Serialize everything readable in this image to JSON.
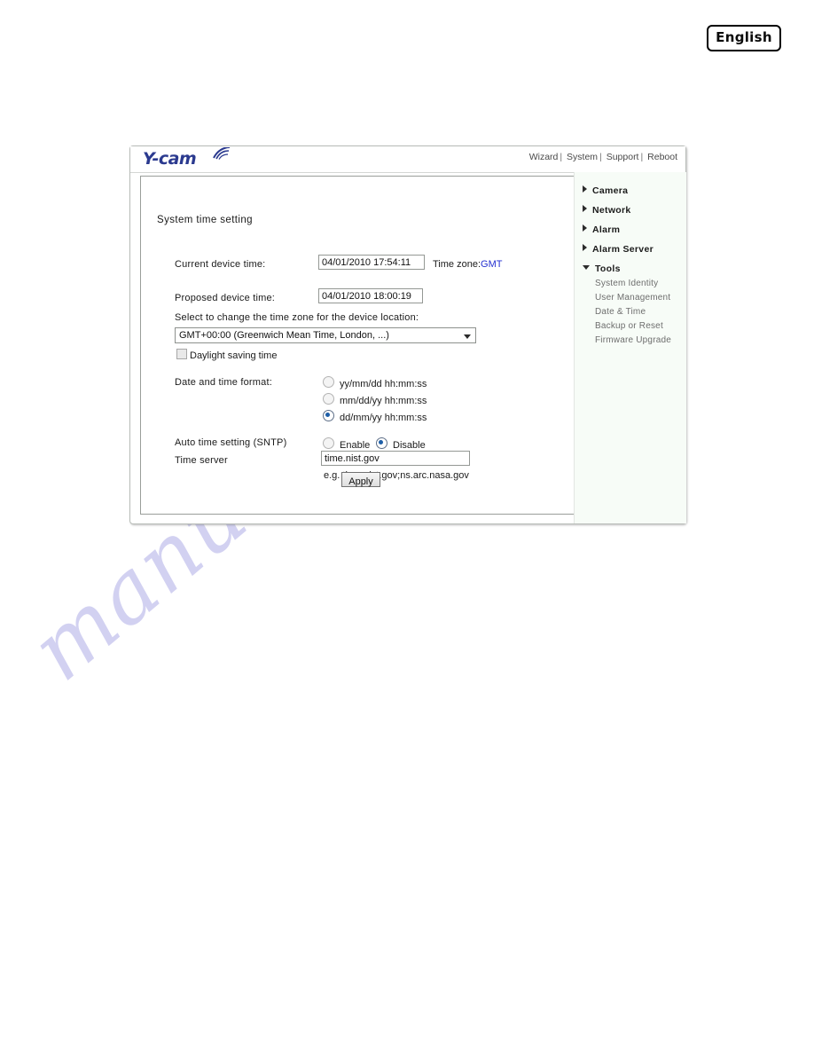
{
  "language_badge": {
    "label": "English"
  },
  "panel": {
    "logo_text": "Y-cam",
    "logo_icon": "wifi-arc-icon",
    "header_nav": [
      {
        "label": "Wizard"
      },
      {
        "label": "System"
      },
      {
        "label": "Support"
      },
      {
        "label": "Reboot"
      }
    ],
    "nav_separator": "|"
  },
  "content": {
    "section_title": "System time setting",
    "current_device_time": {
      "label": "Current device time:",
      "value": "04/01/2010 17:54:11"
    },
    "time_zone": {
      "label": "Time zone:",
      "value": "GMT"
    },
    "proposed_device_time": {
      "label": "Proposed device time:",
      "value": "04/01/2010 18:00:19"
    },
    "timezone_select": {
      "instruction": "Select to change the time zone for the device location:",
      "selected": "GMT+00:00 (Greenwich Mean Time, London, ...)",
      "arrow_icon": "chevron-down-icon"
    },
    "daylight_saving": {
      "label": "Daylight saving time",
      "checked": false
    },
    "date_time_format": {
      "label": "Date and time format:",
      "options": [
        {
          "label": "yy/mm/dd hh:mm:ss",
          "selected": false
        },
        {
          "label": "mm/dd/yy hh:mm:ss",
          "selected": false
        },
        {
          "label": "dd/mm/yy hh:mm:ss",
          "selected": true
        }
      ]
    },
    "sntp": {
      "label": "Auto time setting (SNTP)",
      "options": [
        {
          "label": "Enable",
          "selected": false
        },
        {
          "label": "Disable",
          "selected": true
        }
      ]
    },
    "time_server": {
      "label": "Time server",
      "value": "time.nist.gov",
      "hint": "e.g. time.nist.gov;ns.arc.nasa.gov"
    },
    "apply_button": {
      "label": "Apply"
    }
  },
  "sidebar": {
    "groups": [
      {
        "label": "Camera",
        "expanded": false,
        "icon": "triangle-right-icon"
      },
      {
        "label": "Network",
        "expanded": false,
        "icon": "triangle-right-icon"
      },
      {
        "label": "Alarm",
        "expanded": false,
        "icon": "triangle-right-icon"
      },
      {
        "label": "Alarm Server",
        "expanded": false,
        "icon": "triangle-right-icon"
      },
      {
        "label": "Tools",
        "expanded": true,
        "icon": "triangle-down-icon"
      }
    ],
    "tools_items": [
      {
        "label": "System Identity"
      },
      {
        "label": "User Management"
      },
      {
        "label": "Date & Time"
      },
      {
        "label": "Backup or Reset"
      },
      {
        "label": "Firmware Upgrade"
      }
    ]
  },
  "watermark": {
    "text": "manualshive.com",
    "color": "#c9c8ef"
  }
}
